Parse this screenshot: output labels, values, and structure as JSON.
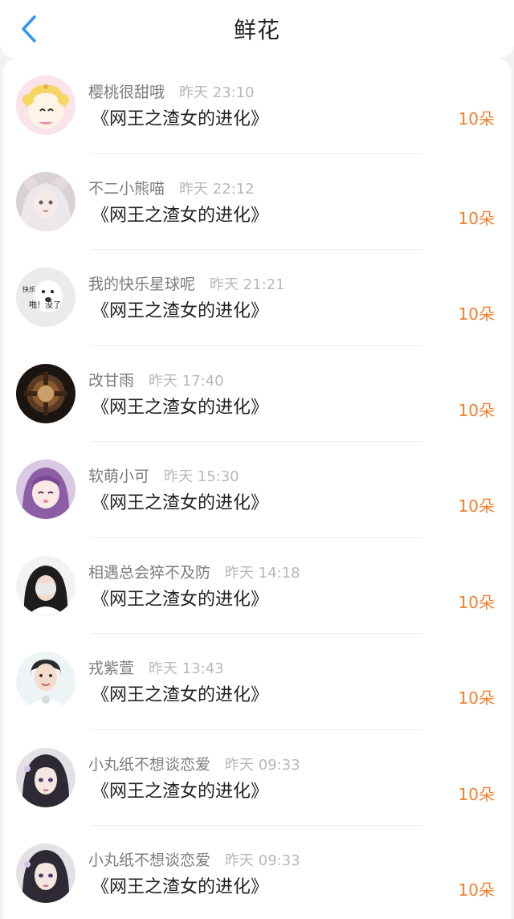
{
  "header": {
    "title": "鲜花",
    "back_icon": "chevron-left-icon",
    "accent": "#2f97f2"
  },
  "colors": {
    "count": "#f07f2c",
    "name": "#7c7c7c",
    "time": "#b8b8b8",
    "book": "#222222"
  },
  "avatar_text": {
    "line1": "快乐",
    "line2": "啪！没了"
  },
  "items": [
    {
      "name": "樱桃很甜哦",
      "time": "昨天 23:10",
      "book": "《网王之渣女的进化》",
      "count": "10朵"
    },
    {
      "name": "不二小熊喵",
      "time": "昨天 22:12",
      "book": "《网王之渣女的进化》",
      "count": "10朵"
    },
    {
      "name": "我的快乐星球呢",
      "time": "昨天 21:21",
      "book": "《网王之渣女的进化》",
      "count": "10朵"
    },
    {
      "name": "改甘雨",
      "time": "昨天 17:40",
      "book": "《网王之渣女的进化》",
      "count": "10朵"
    },
    {
      "name": "软萌小可",
      "time": "昨天 15:30",
      "book": "《网王之渣女的进化》",
      "count": "10朵"
    },
    {
      "name": "相遇总会猝不及防",
      "time": "昨天 14:18",
      "book": "《网王之渣女的进化》",
      "count": "10朵"
    },
    {
      "name": "戎紫萱",
      "time": "昨天 13:43",
      "book": "《网王之渣女的进化》",
      "count": "10朵"
    },
    {
      "name": "小丸纸不想谈恋爱",
      "time": "昨天 09:33",
      "book": "《网王之渣女的进化》",
      "count": "10朵"
    },
    {
      "name": "小丸纸不想谈恋爱",
      "time": "昨天 09:33",
      "book": "《网王之渣女的进化》",
      "count": "10朵"
    }
  ]
}
